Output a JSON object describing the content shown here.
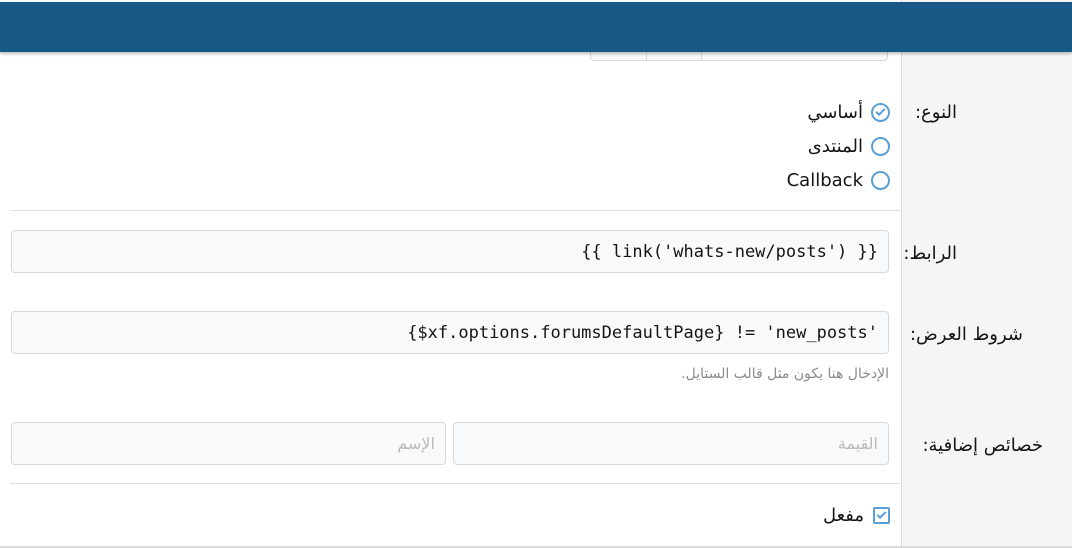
{
  "form": {
    "type_label": "النوع:",
    "type_options": [
      {
        "label": "أساسي",
        "selected": true
      },
      {
        "label": "المنتدى",
        "selected": false
      },
      {
        "label": "Callback",
        "selected": false
      }
    ],
    "link_label": "الرابط:",
    "link_value": "{{ link('whats-new/posts') }}",
    "display_condition_label": "شروط العرض:",
    "display_condition_value": "{$xf.options.forumsDefaultPage} != 'new_posts'",
    "display_condition_hint": "الإدخال هنا يكون مثل قالب الستايل.",
    "extra_attributes_label": "خصائص إضافية:",
    "extra_attr_value_placeholder": "القيمة",
    "extra_attr_name_placeholder": "الإسم",
    "enabled_label": "مفعل",
    "enabled_checked": true
  },
  "colors": {
    "header_bar": "#185886",
    "accent": "#5a9fd6"
  },
  "icons": {
    "radio_selected": "check-circle-icon",
    "radio_unselected": "circle-icon",
    "checkbox_checked": "checkbox-checked-icon"
  }
}
